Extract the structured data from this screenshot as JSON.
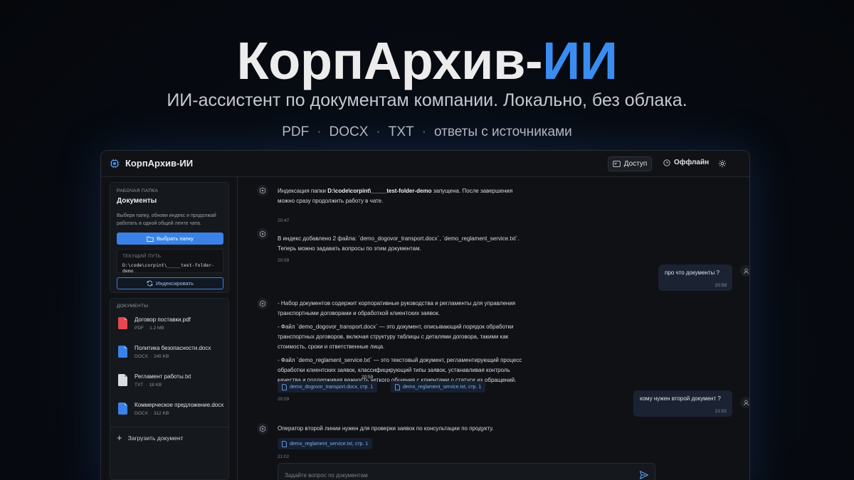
{
  "hero": {
    "title_main": "КорпАрхив-",
    "title_accent": "ИИ",
    "subtitle": "ИИ-ассистент по документам компании. Локально, без облака.",
    "formats": [
      "PDF",
      "DOCX",
      "TXT",
      "ответы с источниками"
    ],
    "separator": "·"
  },
  "app": {
    "name": "КорпАрхив-ИИ",
    "access_label": "Доступ",
    "status_label": "Оффлайн",
    "icons": {
      "logo": "chip-icon",
      "access": "id-card-icon",
      "status": "clock-icon",
      "settings": "gear-icon"
    }
  },
  "sidebar": {
    "folder_section_label": "Рабочая папка",
    "folder_title": "Документы",
    "folder_hint": "Выбери папку, обнови индекс и продолжай работать в одной общей ленте чата.",
    "choose_folder_label": "Выбрать папку",
    "current_path_label": "ТЕКУЩИЙ ПУТЬ",
    "current_path": "D:\\code\\corpint\\_____test-folder-demo",
    "index_label": "Индексировать",
    "docs_section_label": "Документы",
    "documents": [
      {
        "name": "Договор поставки.pdf",
        "type": "PDF",
        "size": "1.2 MB",
        "color": "#e5484d"
      },
      {
        "name": "Политика безопасности.docx",
        "type": "DOCX",
        "size": "245 KB",
        "color": "#3b82e8"
      },
      {
        "name": "Регламент работы.txt",
        "type": "TXT",
        "size": "18 KB",
        "color": "#d9dce1"
      },
      {
        "name": "Коммерческое предложение.docx",
        "type": "DOCX",
        "size": "312 KB",
        "color": "#3b82e8"
      }
    ],
    "upload_label": "Загрузить документ"
  },
  "chat": {
    "messages": [
      {
        "role": "assistant",
        "text_before": "Индексация папки ",
        "text_bold": "D:\\code\\corpint\\_____test-folder-demo",
        "text_after": " запущена. После завершения",
        "text_line2": "можно сразу продолжить работу в чате.",
        "time": "20:47"
      },
      {
        "role": "assistant",
        "line1": "В индекс добавлено 2 файла: `demo_dogovor_transport.docx`, `demo_reglament_service.txt`.",
        "line2": "Теперь можно задавать вопросы по этим документам.",
        "time": "20:59"
      },
      {
        "role": "user",
        "text": "про что документы ?",
        "time": "20:59"
      },
      {
        "role": "assistant",
        "p1_l1": "- Набор документов содержит корпоративные руководства и регламенты для управления",
        "p1_l2": "транспортными договорами и обработкой клиентских заявок.",
        "p2_l1": "- Файл `demo_dogovor_transport.docx` — это документ, описывающий порядок обработки",
        "p2_l2": "транспортных договоров, включая структуру таблицы с деталями договора, такими как",
        "p2_l3": "стоимость, сроки и ответственные лица.",
        "p3_l1": "- Файл `demo_reglament_service.txt` — это текстовый документ, регламентирующий процесс",
        "p3_l2": "обработки клиентских заявок, классифицирующий типы заявок, устанавливая контроль",
        "p3_l3": "качества и поддерживая важность четкого общения с клиентами о статусе их обращений.",
        "overlap_time": "20:59",
        "sources": [
          "demo_dogovor_transport.docx, стр. 1",
          "demo_reglament_service.txt, стр. 1"
        ],
        "time": "20:59"
      },
      {
        "role": "user",
        "text": "кому нужен второй документ ?",
        "time": "21:02"
      },
      {
        "role": "assistant",
        "text": "Оператор второй линии нужен для проверки заявок по консультации по продукту.",
        "sources": [
          "demo_reglament_service.txt, стр. 1"
        ],
        "time": "21:02"
      }
    ],
    "composer_placeholder": "Задайте вопрос по документам"
  }
}
